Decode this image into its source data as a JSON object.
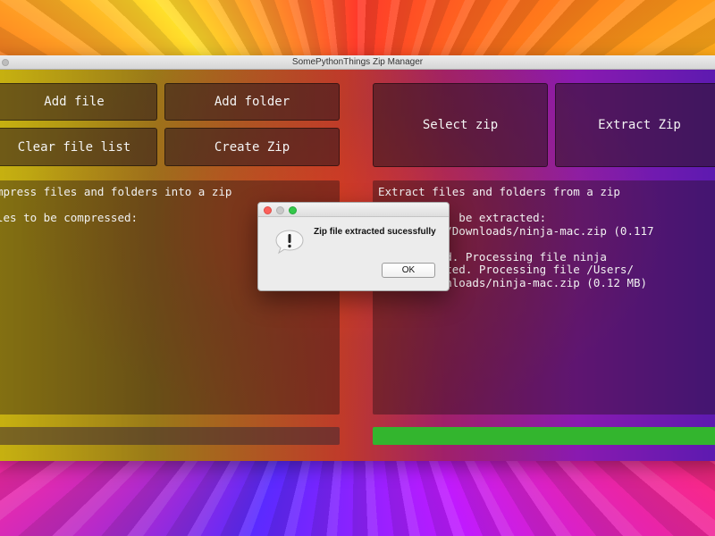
{
  "window": {
    "title": "SomePythonThings Zip Manager"
  },
  "compress": {
    "add_file_label": "Add file",
    "add_folder_label": "Add folder",
    "clear_list_label": "Clear file list",
    "create_zip_label": "Create Zip",
    "log_text": "mpress files and folders into a zip\n\nles to be compressed:",
    "progress_percent": 0
  },
  "extract": {
    "select_zip_label": "Select zip",
    "extract_zip_label": "Extract Zip",
    "log_text": "Extract files and folders from a zip\n\n            be extracted:\n   iclilop/Downloads/ninja-mac.zip (0.117\n\n       eted. Processing file ninja\n       pleted. Processing file /Users/\n      /Downloads/ninja-mac.zip (0.12 MB)",
    "progress_percent": 100,
    "progress_color": "#33b52e"
  },
  "dialog": {
    "message": "Zip file extracted sucessfully",
    "ok_label": "OK",
    "icon": "warning-icon"
  }
}
